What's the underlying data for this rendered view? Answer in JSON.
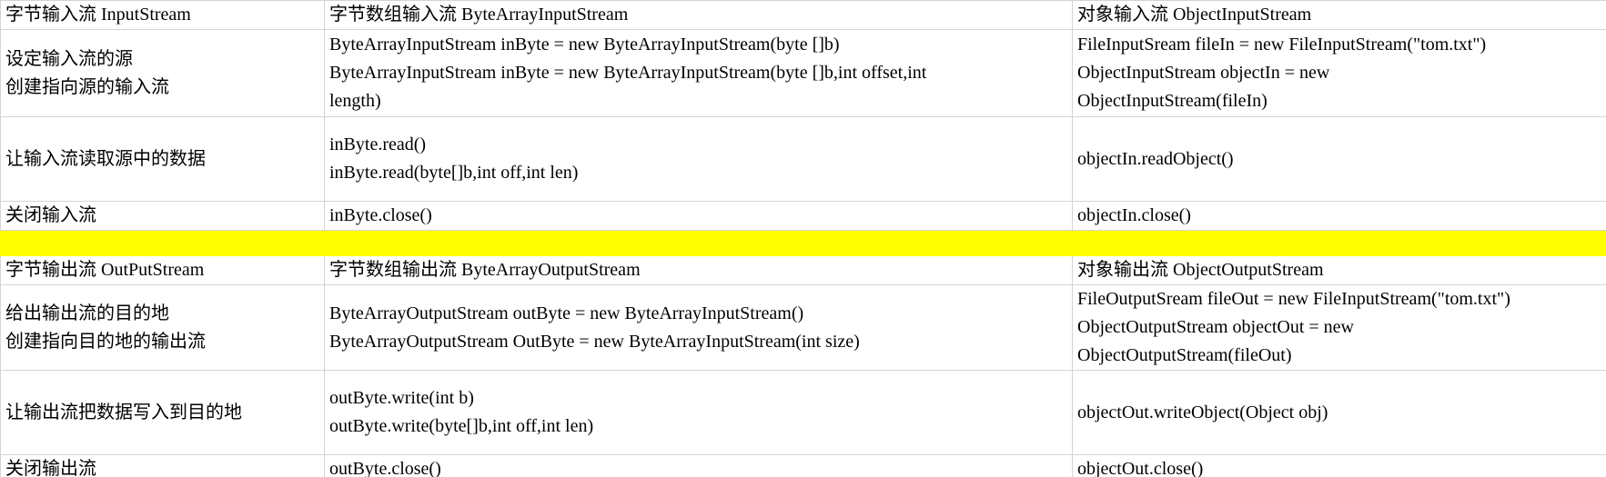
{
  "input_section": {
    "headers": [
      "字节输入流 InputStream",
      "字节数组输入流 ByteArrayInputStream",
      "对象输入流 ObjectInputStream"
    ],
    "rows": [
      {
        "step": [
          "设定输入流的源",
          "创建指向源的输入流"
        ],
        "byte_array": [
          "ByteArrayInputStream inByte = new ByteArrayInputStream(byte []b)",
          "ByteArrayInputStream inByte = new ByteArrayInputStream(byte []b,int offset,int",
          "length)"
        ],
        "object": [
          "FileInputSream fileIn = new FileInputStream(\"tom.txt\")",
          "ObjectInputStream objectIn = new",
          "ObjectInputStream(fileIn)"
        ]
      },
      {
        "step": [
          "让输入流读取源中的数据"
        ],
        "byte_array": [
          "inByte.read()",
          "inByte.read(byte[]b,int off,int len)"
        ],
        "object": [
          "objectIn.readObject()"
        ]
      },
      {
        "step": [
          "关闭输入流"
        ],
        "byte_array": [
          "inByte.close()"
        ],
        "object": [
          "objectIn.close()"
        ]
      }
    ]
  },
  "separator": {
    "color": "#ffff00"
  },
  "output_section": {
    "headers": [
      "字节输出流 OutPutStream",
      "字节数组输出流 ByteArrayOutputStream",
      "对象输出流 ObjectOutputStream"
    ],
    "rows": [
      {
        "step": [
          "给出输出流的目的地",
          "创建指向目的地的输出流"
        ],
        "byte_array": [
          "ByteArrayOutputStream outByte = new ByteArrayInputStream()",
          "ByteArrayOutputStream OutByte = new ByteArrayInputStream(int size)"
        ],
        "object": [
          "FileOutputSream fileOut = new FileInputStream(\"tom.txt\")",
          "ObjectOutputStream objectOut = new",
          "ObjectOutputStream(fileOut)"
        ]
      },
      {
        "step": [
          "让输出流把数据写入到目的地"
        ],
        "byte_array": [
          "outByte.write(int b)",
          "outByte.write(byte[]b,int off,int len)"
        ],
        "object": [
          "objectOut.writeObject(Object obj)"
        ]
      },
      {
        "step": [
          "关闭输出流"
        ],
        "byte_array": [
          "outByte.close()"
        ],
        "object": [
          "objectOut.close()"
        ]
      }
    ]
  }
}
